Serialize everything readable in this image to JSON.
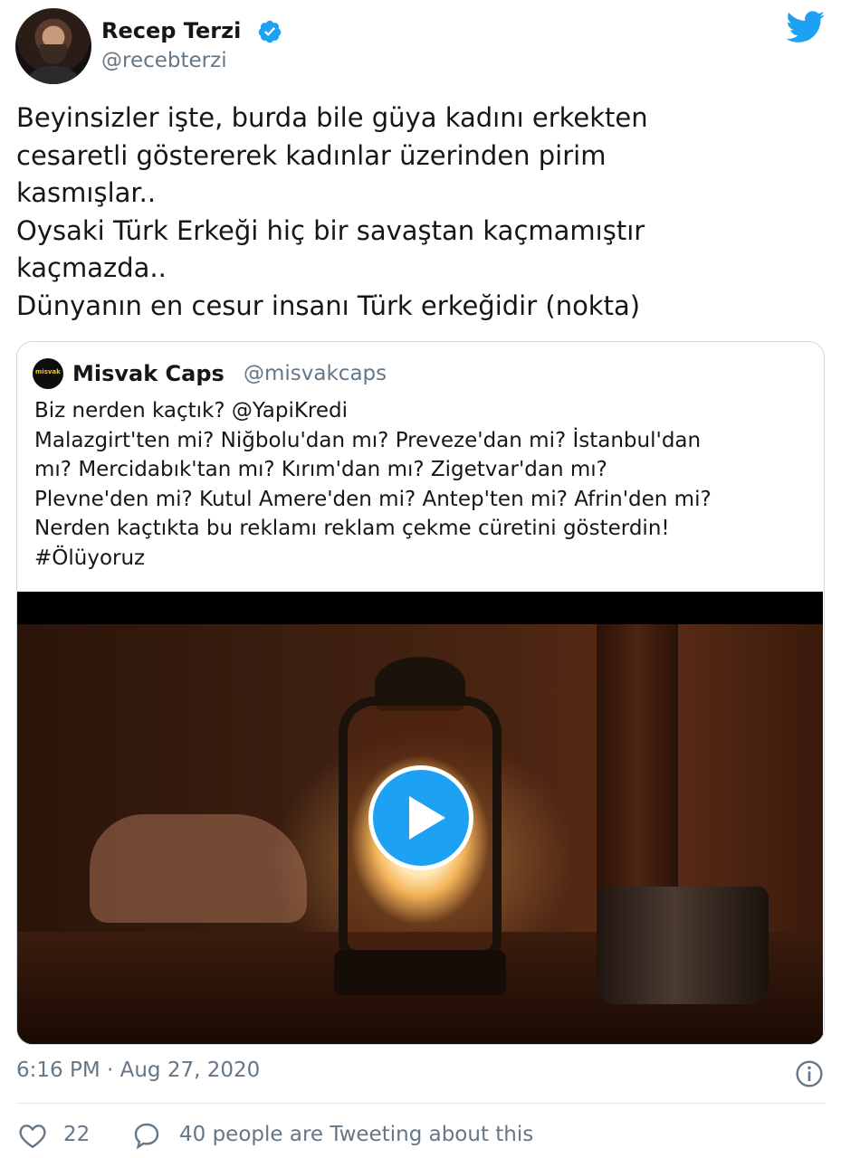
{
  "author": {
    "display_name": "Recep Terzi",
    "handle": "@recebterzi",
    "verified": true
  },
  "tweet": {
    "lines": [
      "Beyinsizler işte, burda bile güya kadını erkekten",
      "cesaretli göstererek kadınlar üzerinden pirim",
      "kasmışlar..",
      "Oysaki Türk Erkeği hiç bir savaştan kaçmamıştır",
      "kaçmazda..",
      "Dünyanın en cesur insanı Türk erkeğidir (nokta)"
    ]
  },
  "quoted_tweet": {
    "display_name": "Misvak Caps",
    "handle": "@misvakcaps",
    "avatar_text": "misvak caps",
    "lines": [
      "Biz nerden kaçtık? @YapiKredi",
      "Malazgirt'ten mi? Niğbolu'dan mı? Preveze'dan mi? İstanbul'dan",
      "mı? Mercidabık'tan mı? Kırım'dan mı? Zigetvar'dan mı?",
      "Plevne'den mi? Kutul Amere'den mi? Antep'ten mi?  Afrin'den mi?",
      "Nerden kaçtıkta bu reklamı reklam çekme cüretini gösterdin!",
      "#Ölüyoruz"
    ]
  },
  "footer": {
    "timestamp": "6:16 PM · Aug 27, 2020",
    "like_count": "22",
    "engagement_text": "40 people are Tweeting about this"
  },
  "colors": {
    "accent": "#1da1f2",
    "text": "#14171a",
    "secondary": "#657786",
    "border": "#cfd9de"
  },
  "icons": [
    "verified-icon",
    "twitter-bird-icon",
    "play-icon",
    "info-icon",
    "heart-icon",
    "speech-bubble-icon"
  ]
}
